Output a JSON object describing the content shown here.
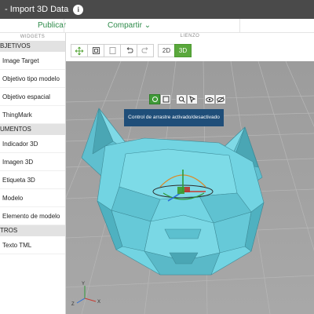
{
  "app": {
    "title": "- Import 3D Data",
    "info_glyph": "i"
  },
  "toolbar": {
    "publish_label": "Publicar",
    "share_label": "Compartir",
    "share_chevron": "⌄"
  },
  "sidebar": {
    "header": "WIDGETS",
    "sections": [
      {
        "label": "BJETIVOS",
        "items": [
          "Image Target",
          "Objetivo tipo modelo",
          "Objetivo espacial",
          "ThingMark"
        ]
      },
      {
        "label": "UMENTOS",
        "items": [
          "Indicador 3D",
          "Imagen 3D",
          "Etiqueta 3D",
          "Modelo",
          "Elemento de modelo"
        ]
      },
      {
        "label": "TROS",
        "items": [
          "Texto TML"
        ]
      }
    ]
  },
  "canvas": {
    "label": "LIENZO",
    "mode_2d": "2D",
    "mode_3d": "3D",
    "active_mode": "3D",
    "tooltip": "Control de arrastre activado/desactivado"
  },
  "colors": {
    "accent": "#2e8b4a",
    "active_button": "#5aa83c",
    "model": "#6ed0df",
    "tooltip_bg": "#1f4e79",
    "floor": "#a3a3a3"
  },
  "axes": {
    "x": "X",
    "y": "Y",
    "z": "Z"
  }
}
